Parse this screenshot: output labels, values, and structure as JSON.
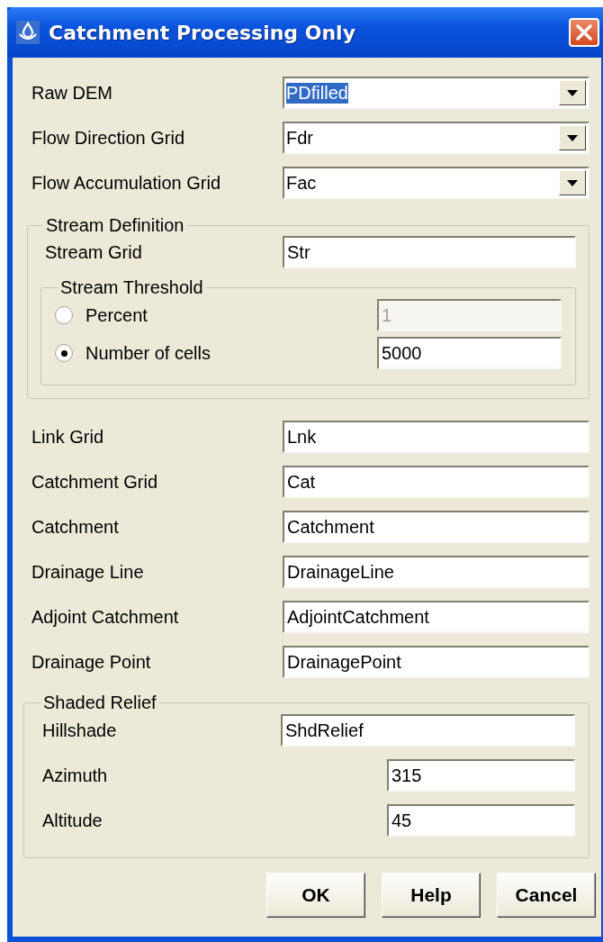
{
  "window": {
    "title": "Catchment Processing Only"
  },
  "dropdowns": [
    {
      "label": "Raw DEM",
      "value": "PDfilled",
      "selected": true
    },
    {
      "label": "Flow Direction Grid",
      "value": "Fdr",
      "selected": false
    },
    {
      "label": "Flow Accumulation Grid",
      "value": "Fac",
      "selected": false
    }
  ],
  "stream_definition": {
    "title": "Stream Definition",
    "stream_grid": {
      "label": "Stream Grid",
      "value": "Str"
    },
    "threshold": {
      "title": "Stream Threshold",
      "options": [
        {
          "label": "Percent",
          "value": "1",
          "selected": false,
          "disabled": true
        },
        {
          "label": "Number of cells",
          "value": "5000",
          "selected": true,
          "disabled": false
        }
      ]
    }
  },
  "fields": [
    {
      "label": "Link Grid",
      "value": "Lnk"
    },
    {
      "label": "Catchment Grid",
      "value": "Cat"
    },
    {
      "label": "Catchment",
      "value": "Catchment"
    },
    {
      "label": "Drainage Line",
      "value": "DrainageLine"
    },
    {
      "label": "Adjoint Catchment",
      "value": "AdjointCatchment"
    },
    {
      "label": "Drainage Point",
      "value": "DrainagePoint"
    }
  ],
  "shaded_relief": {
    "title": "Shaded Relief",
    "fields": [
      {
        "label": "Hillshade",
        "value": "ShdRelief",
        "kind": "wide"
      },
      {
        "label": "Azimuth",
        "value": "315",
        "kind": "narrow"
      },
      {
        "label": "Altitude",
        "value": "45",
        "kind": "narrow"
      }
    ]
  },
  "buttons": [
    "OK",
    "Help",
    "Cancel"
  ]
}
